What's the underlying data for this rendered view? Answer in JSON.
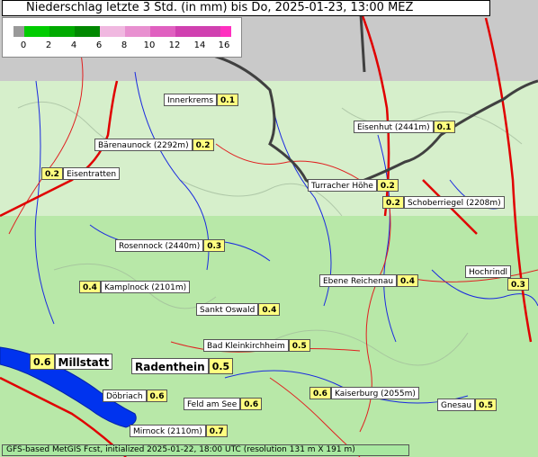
{
  "title": "Niederschlag letzte 3 Std. (in mm) bis Do, 2025-01-23, 13:00 MEZ",
  "legend": {
    "ticks": [
      "0",
      "2",
      "4",
      "6",
      "8",
      "10",
      "12",
      "14",
      "16"
    ],
    "colors": [
      "#00cc00",
      "#00aa00",
      "#008800",
      "#f0b8e0",
      "#e890d0",
      "#e060c0",
      "#d040b0"
    ]
  },
  "places": [
    {
      "name": "Innerkrems",
      "value": "0.1"
    },
    {
      "name": "Bärenaunock (2292m)",
      "value": "0.2"
    },
    {
      "name": "Eisenhut (2441m)",
      "value": "0.1"
    },
    {
      "name": "Eisentratten",
      "value": "0.2"
    },
    {
      "name": "Turracher Höhe",
      "value": "0.2"
    },
    {
      "name": "Schoberriegel (2208m)",
      "value": "0.2"
    },
    {
      "name": "Rosennock (2440m)",
      "value": "0.3"
    },
    {
      "name": "Hochrindl",
      "value": "0.3"
    },
    {
      "name": "Ebene Reichenau",
      "value": "0.4"
    },
    {
      "name": "Kamplnock (2101m)",
      "value": "0.4"
    },
    {
      "name": "Sankt Oswald",
      "value": "0.4"
    },
    {
      "name": "Bad Kleinkirchheim",
      "value": "0.5"
    },
    {
      "name": "Millstatt",
      "value": "0.6"
    },
    {
      "name": "Radenthein",
      "value": "0.5"
    },
    {
      "name": "Döbriach",
      "value": "0.6"
    },
    {
      "name": "Feld am See",
      "value": "0.6"
    },
    {
      "name": "Kaiserburg (2055m)",
      "value": "0.6"
    },
    {
      "name": "Gnesau",
      "value": "0.5"
    },
    {
      "name": "Mirnock (2110m)",
      "value": "0.7"
    }
  ],
  "footer": "GFS-based MetGIS Fcst, initialized 2025-01-22, 18:00 UTC  (resolution 131 m X 191 m)"
}
